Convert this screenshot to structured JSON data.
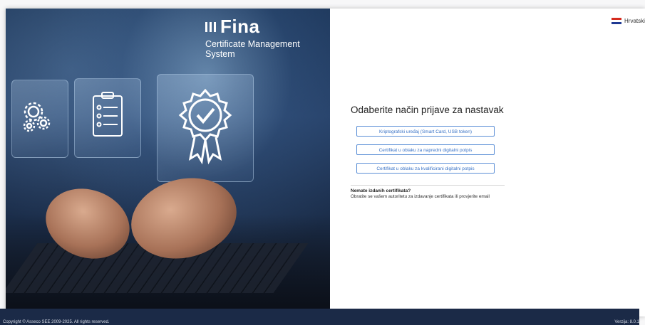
{
  "brand": {
    "logo_text": "Fina",
    "product_name": "Certificate Management System"
  },
  "language": {
    "label": "Hrvatski"
  },
  "login": {
    "title": "Odaberite način prijave za nastavak",
    "options": [
      "Kriptografski uređaj (Smart Card, USB token)",
      "Certifikat u oblaku za napredni digitalni potpis",
      "Certifikat u oblaku za kvalificirani digitalni potpis"
    ]
  },
  "help": {
    "title": "Nemate izdanih certifikata?",
    "text": "Obratite se vašem autoritetu za izdavanje certifikata ili provjerite email"
  },
  "footer": {
    "copyright": "Copyright © Asseco SEE 2009-2025. All rights reserved.",
    "version": "Verzija: 8.0.1"
  },
  "colors": {
    "accent": "#3a73c6",
    "footer_bg": "#1b2a47",
    "hero_dark": "#1c3558"
  },
  "icons": [
    "gears-icon",
    "checklist-icon",
    "certificate-badge-icon",
    "croatia-flag-icon"
  ]
}
